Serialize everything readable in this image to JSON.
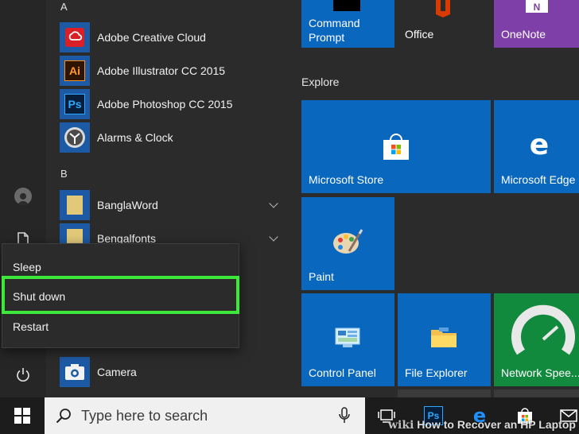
{
  "app_list": {
    "letters": {
      "a": "A",
      "b": "B"
    },
    "apps": [
      {
        "label": "Adobe Creative Cloud",
        "icon": "creative-cloud-icon"
      },
      {
        "label": "Adobe Illustrator CC 2015",
        "icon": "illustrator-icon",
        "badge": "Ai"
      },
      {
        "label": "Adobe Photoshop CC 2015",
        "icon": "photoshop-icon",
        "badge": "Ps"
      },
      {
        "label": "Alarms & Clock",
        "icon": "clock-icon"
      },
      {
        "label": "BanglaWord",
        "icon": "folder-icon"
      },
      {
        "label": "Bengalfonts",
        "icon": "folder-icon"
      },
      {
        "label": "Camera",
        "icon": "camera-icon"
      }
    ]
  },
  "power_menu": {
    "items": [
      "Sleep",
      "Shut down",
      "Restart"
    ],
    "highlight_color": "#3ee83a"
  },
  "tiles": {
    "section_title": "Explore",
    "command_prompt": "Command Prompt",
    "office": "Office",
    "onenote": "OneNote",
    "microsoft_store": "Microsoft Store",
    "microsoft_edge": "Microsoft Edge",
    "paint": "Paint",
    "control_panel": "Control Panel",
    "file_explorer": "File Explorer",
    "network_speed": "Network Spee..."
  },
  "taskbar": {
    "search_placeholder": "Type here to search",
    "ps_badge": "Ps"
  },
  "watermark": {
    "wiki": "wiki",
    "text": "How to Recover an HP Laptop"
  },
  "colors": {
    "tile_blue": "#0a67be",
    "menu_bg": "#2b2b2b",
    "onenote_purple": "#7e3fa8",
    "highlight": "#3ee83a"
  }
}
